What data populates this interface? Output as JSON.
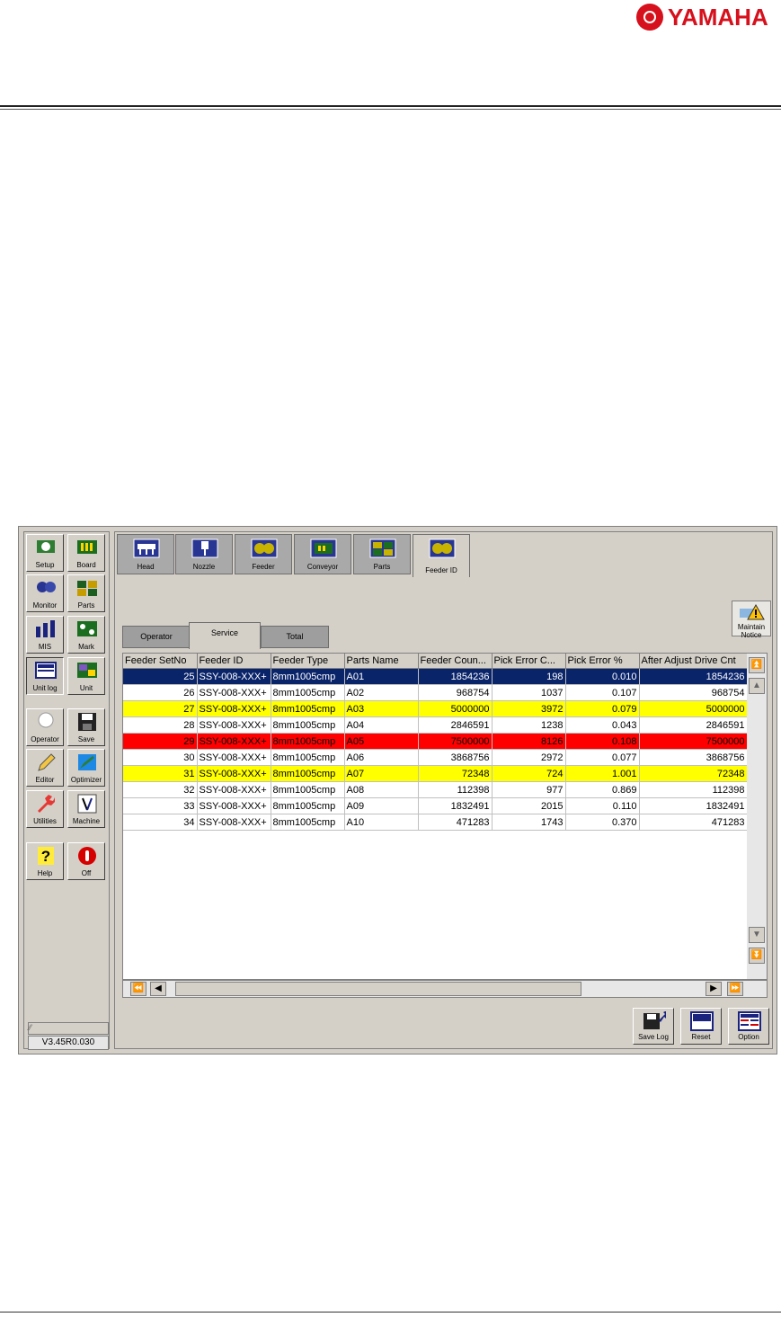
{
  "brand": "YAMAHA",
  "left_buttons": [
    {
      "label": "Setup",
      "icon": "setup-icon"
    },
    {
      "label": "Board",
      "icon": "board-icon"
    },
    {
      "label": "Monitor",
      "icon": "monitor-icon"
    },
    {
      "label": "Parts",
      "icon": "parts-icon"
    },
    {
      "label": "MIS",
      "icon": "mis-icon"
    },
    {
      "label": "Mark",
      "icon": "mark-icon"
    },
    {
      "label": "Unit log",
      "icon": "unit-log-icon"
    },
    {
      "label": "Unit",
      "icon": "unit-icon"
    },
    {
      "label": "Operator",
      "icon": "operator-icon"
    },
    {
      "label": "Save",
      "icon": "save-icon"
    },
    {
      "label": "Editor",
      "icon": "editor-icon"
    },
    {
      "label": "Optimizer",
      "icon": "optimizer-icon"
    },
    {
      "label": "Utilities",
      "icon": "utilities-icon"
    },
    {
      "label": "Machine",
      "icon": "machine-icon"
    },
    {
      "label": "Help",
      "icon": "help-icon"
    },
    {
      "label": "Off",
      "icon": "power-off-icon"
    }
  ],
  "version": "V3.45R0.030",
  "top_tabs": [
    "Head",
    "Nozzle",
    "Feeder",
    "Conveyor",
    "Parts",
    "Feeder ID"
  ],
  "active_top_tab": "Feeder ID",
  "sub_tabs": [
    "Operator",
    "Service",
    "Total"
  ],
  "active_sub_tab": "Service",
  "maintain_notice": {
    "line1": "Maintain",
    "line2": "Notice"
  },
  "table": {
    "columns": [
      "Feeder SetNo",
      "Feeder ID",
      "Feeder Type",
      "Parts Name",
      "Feeder Coun...",
      "Pick Error C...",
      "Pick Error %",
      "After Adjust Drive Cnt"
    ],
    "rows": [
      [
        "25",
        "SSY-008-XXX+",
        "8mm1005cmp",
        "A01",
        "1854236",
        "198",
        "0.010",
        "1854236"
      ],
      [
        "26",
        "SSY-008-XXX+",
        "8mm1005cmp",
        "A02",
        "968754",
        "1037",
        "0.107",
        "968754"
      ],
      [
        "27",
        "SSY-008-XXX+",
        "8mm1005cmp",
        "A03",
        "5000000",
        "3972",
        "0.079",
        "5000000"
      ],
      [
        "28",
        "SSY-008-XXX+",
        "8mm1005cmp",
        "A04",
        "2846591",
        "1238",
        "0.043",
        "2846591"
      ],
      [
        "29",
        "SSY-008-XXX+",
        "8mm1005cmp",
        "A05",
        "7500000",
        "8126",
        "0.108",
        "7500000"
      ],
      [
        "30",
        "SSY-008-XXX+",
        "8mm1005cmp",
        "A06",
        "3868756",
        "2972",
        "0.077",
        "3868756"
      ],
      [
        "31",
        "SSY-008-XXX+",
        "8mm1005cmp",
        "A07",
        "72348",
        "724",
        "1.001",
        "72348"
      ],
      [
        "32",
        "SSY-008-XXX+",
        "8mm1005cmp",
        "A08",
        "112398",
        "977",
        "0.869",
        "112398"
      ],
      [
        "33",
        "SSY-008-XXX+",
        "8mm1005cmp",
        "A09",
        "1832491",
        "2015",
        "0.110",
        "1832491"
      ],
      [
        "34",
        "SSY-008-XXX+",
        "8mm1005cmp",
        "A10",
        "471283",
        "1743",
        "0.370",
        "471283"
      ]
    ],
    "row_states": [
      "selected",
      "normal",
      "warning",
      "normal",
      "error",
      "normal",
      "warning",
      "normal",
      "normal",
      "normal"
    ]
  },
  "bottom_buttons": [
    {
      "label": "Save Log",
      "icon": "save-log-icon"
    },
    {
      "label": "Reset",
      "icon": "reset-icon"
    },
    {
      "label": "Option",
      "icon": "option-icon"
    }
  ],
  "colors": {
    "selected": "#0a246a",
    "warning": "#ffff00",
    "error": "#ff0000",
    "brand": "#d6101c"
  }
}
